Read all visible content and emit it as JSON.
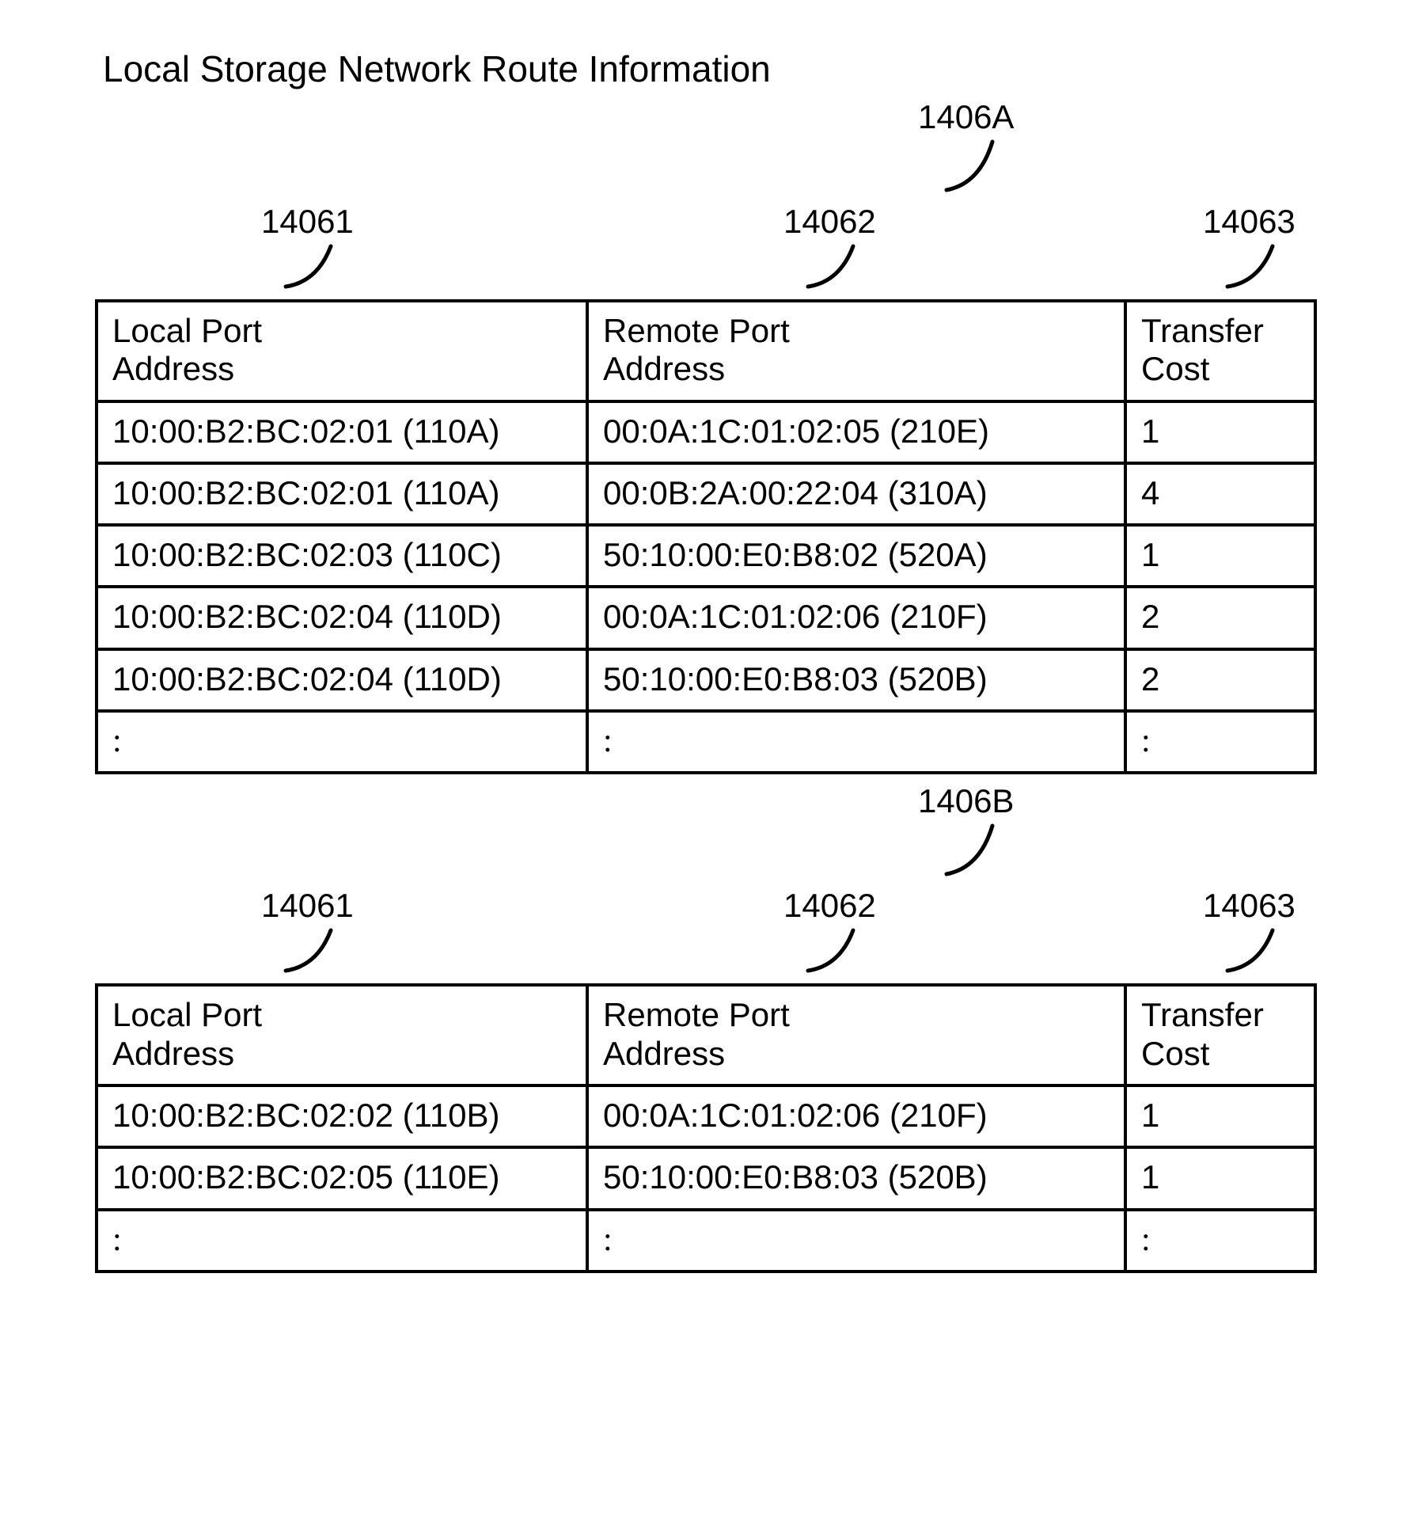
{
  "title": "Local Storage Network Route Information",
  "ellipsis_glyph": ":",
  "tables": [
    {
      "outer_callout": "1406A",
      "col_callouts": {
        "c1": "14061",
        "c2": "14062",
        "c3": "14063"
      },
      "headers": {
        "local_port": "Local Port\nAddress",
        "remote_port": "Remote Port\nAddress",
        "transfer_cost": "Transfer\nCost"
      },
      "rows": [
        {
          "local": "10:00:B2:BC:02:01 (110A)",
          "remote": "00:0A:1C:01:02:05 (210E)",
          "cost": "1"
        },
        {
          "local": "10:00:B2:BC:02:01 (110A)",
          "remote": "00:0B:2A:00:22:04 (310A)",
          "cost": "4"
        },
        {
          "local": "10:00:B2:BC:02:03 (110C)",
          "remote": "50:10:00:E0:B8:02 (520A)",
          "cost": "1"
        },
        {
          "local": "10:00:B2:BC:02:04 (110D)",
          "remote": "00:0A:1C:01:02:06 (210F)",
          "cost": "2"
        },
        {
          "local": "10:00:B2:BC:02:04 (110D)",
          "remote": "50:10:00:E0:B8:03 (520B)",
          "cost": "2"
        }
      ]
    },
    {
      "outer_callout": "1406B",
      "col_callouts": {
        "c1": "14061",
        "c2": "14062",
        "c3": "14063"
      },
      "headers": {
        "local_port": "Local Port\nAddress",
        "remote_port": "Remote Port\nAddress",
        "transfer_cost": "Transfer\nCost"
      },
      "rows": [
        {
          "local": "10:00:B2:BC:02:02 (110B)",
          "remote": "00:0A:1C:01:02:06 (210F)",
          "cost": "1"
        },
        {
          "local": "10:00:B2:BC:02:05 (110E)",
          "remote": "50:10:00:E0:B8:03 (520B)",
          "cost": "1"
        }
      ]
    }
  ]
}
